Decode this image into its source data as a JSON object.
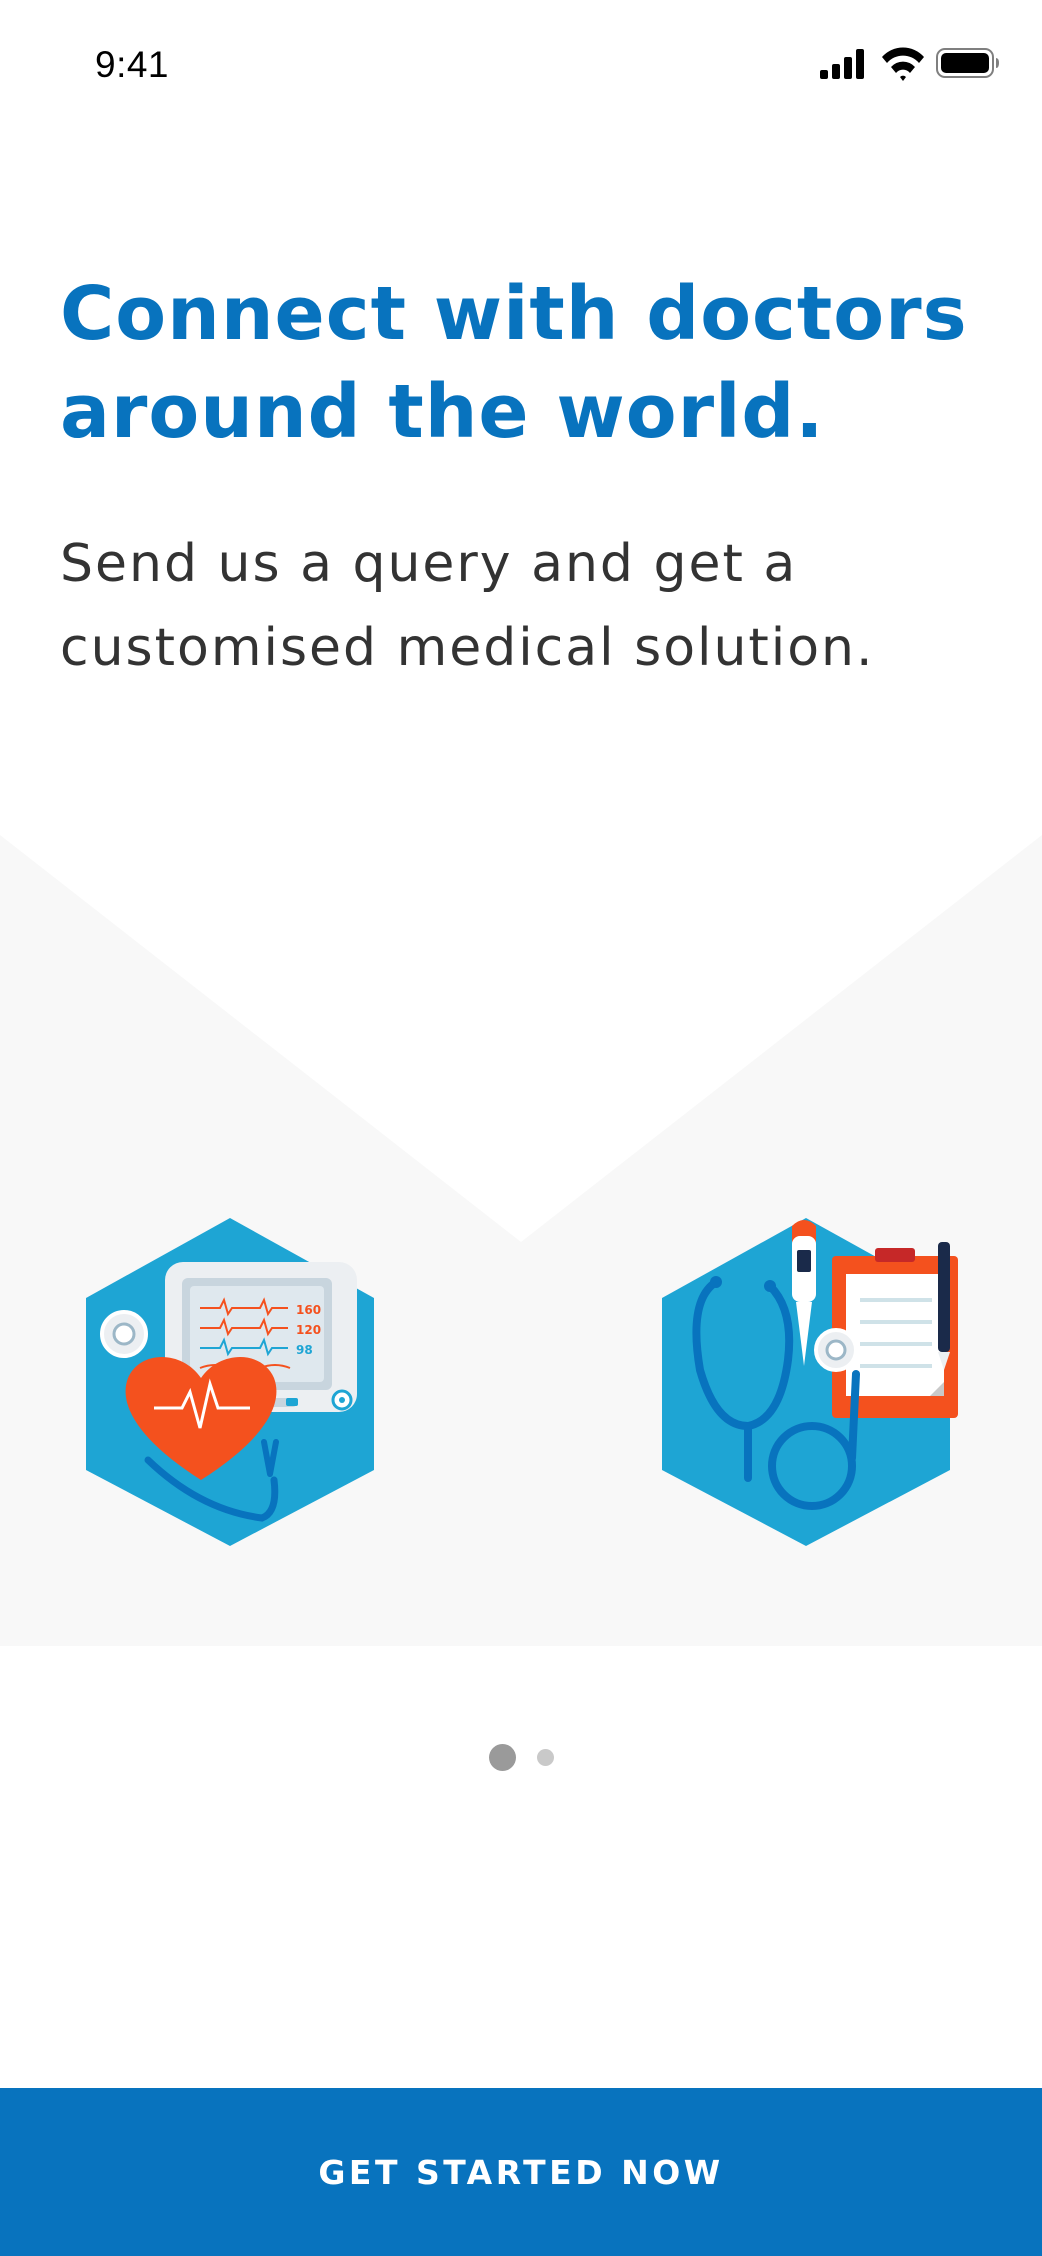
{
  "status_bar": {
    "time": "9:41",
    "icons": [
      "cellular-signal-icon",
      "wifi-icon",
      "battery-icon"
    ]
  },
  "onboarding": {
    "headline": "Connect with doctors around the world.",
    "subheadline": "Send us a query and get a customised medical solution.",
    "illustrations": [
      "heart-monitor-illustration",
      "stethoscope-clipboard-illustration"
    ],
    "monitor_readings": [
      "160",
      "120",
      "98"
    ],
    "pager": {
      "page_count": 2,
      "current_page": 1
    }
  },
  "cta": {
    "label": "GET STARTED NOW"
  },
  "colors": {
    "brand_blue": "#0873be",
    "hex_blue": "#1ea5d4",
    "accent_orange": "#f4511e",
    "text_dark": "#333333",
    "panel_gray": "#f8f8f8"
  }
}
